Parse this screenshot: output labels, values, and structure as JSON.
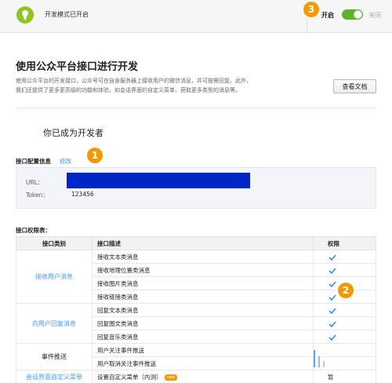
{
  "header": {
    "status_text": "开发模式已开启",
    "on_label": "开启",
    "off_label": "关闭"
  },
  "badges": {
    "b1": "1",
    "b2": "2",
    "b3": "3"
  },
  "intro": {
    "title": "使用公众平台接口进行开发",
    "desc_line1": "使用公众平台的开发接口，公众号可在自身服务器上接收用户的微信消息，并可按需回复。此外，",
    "desc_line2": "我们还提供了更多更高级的功能和体验，如会话界面的自定义菜单、获取更多类型的消息等。",
    "doc_button": "查看文档"
  },
  "developer_title": "你已成为开发者",
  "config": {
    "label": "接口配置信息",
    "edit_link": "修改",
    "url_key": "URL：",
    "token_key": "Token：",
    "token_value": "123456"
  },
  "permissions": {
    "label": "接口权限表：",
    "columns": [
      "接口类别",
      "接口描述",
      "权限"
    ],
    "groups": [
      {
        "name": "接收用户消息",
        "rows": [
          "接收文本类消息",
          "接收地理位置类消息",
          "接收图片类消息",
          "接收链接类消息"
        ]
      },
      {
        "name": "向用户回复消息",
        "rows": [
          "回复文本类消息",
          "回复图文类消息",
          "回复音乐类消息"
        ]
      },
      {
        "name": "事件推送",
        "rows": [
          "用户关注事件推送",
          "用户取消关注事件推送"
        ]
      },
      {
        "name": "会话界面自定义菜单",
        "rows": [
          "设置自定义菜单（内测）"
        ]
      }
    ],
    "new_tag": "new",
    "partial_perm": "暂"
  },
  "colors": {
    "accent_green": "#5bb32a",
    "badge_orange": "#f39800",
    "link_blue": "#459ae9",
    "redaction_blue": "#0026c8"
  }
}
